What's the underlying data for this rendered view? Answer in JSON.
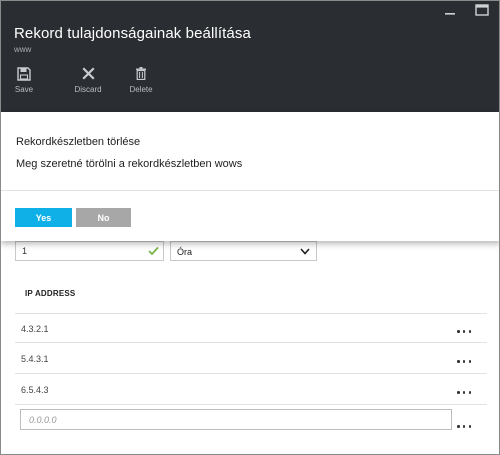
{
  "window": {
    "title": "Rekord tulajdonságainak beállítása",
    "subtitle": "www"
  },
  "toolbar": {
    "save_label": "Save",
    "discard_label": "Discard",
    "delete_label": "Delete"
  },
  "dialog": {
    "title": "Rekordkészletben törlése",
    "message": "Meg szeretné törölni a rekordkészletben wows",
    "yes_label": "Yes",
    "no_label": "No"
  },
  "ttl": {
    "value": "1",
    "unit": "Óra"
  },
  "ip_section": {
    "header": "IP ADDRESS",
    "addresses": [
      "4.3.2.1",
      "5.4.3.1",
      "6.5.4.3"
    ],
    "new_placeholder": "0.0.0.0"
  },
  "colors": {
    "header_bg": "#2a2d31",
    "accent": "#0fb0e8",
    "secondary_button": "#a7a7a7",
    "valid_check": "#7ab648"
  },
  "icons": [
    "minimize-icon",
    "maximize-icon",
    "save-icon",
    "discard-icon",
    "delete-icon",
    "checkmark-icon",
    "chevron-down-icon",
    "more-icon"
  ]
}
